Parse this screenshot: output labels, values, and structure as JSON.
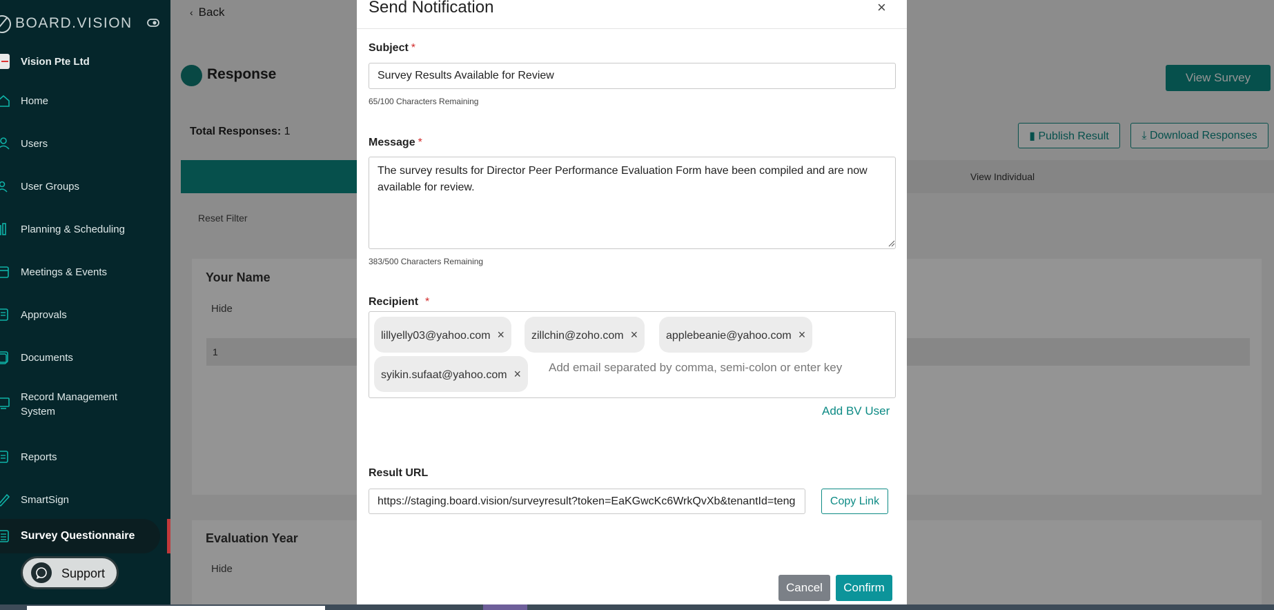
{
  "sidebar": {
    "brand": "BOARD.VISION",
    "company": "Vision Pte Ltd",
    "items": [
      {
        "label": "Home",
        "icon": "home-icon"
      },
      {
        "label": "Users",
        "icon": "user-icon"
      },
      {
        "label": "User Groups",
        "icon": "user-group-icon"
      },
      {
        "label": "Planning & Scheduling",
        "icon": "planning-icon"
      },
      {
        "label": "Meetings & Events",
        "icon": "calendar-icon"
      },
      {
        "label": "Approvals",
        "icon": "approvals-icon"
      },
      {
        "label": "Documents",
        "icon": "documents-icon"
      },
      {
        "label": "Record Management System",
        "icon": "records-icon"
      },
      {
        "label": "Reports",
        "icon": "reports-icon"
      },
      {
        "label": "SmartSign",
        "icon": "pen-icon"
      },
      {
        "label": "Survey Questionnaire",
        "icon": "survey-icon",
        "active": true
      }
    ],
    "support": "Support"
  },
  "page": {
    "back": "Back",
    "title": "Response",
    "view_survey": "View Survey",
    "total_label": "Total Responses:",
    "total_value": "1",
    "publish_result": "Publish Result",
    "download_responses": "Download Responses",
    "tab_individual": "View Individual",
    "reset_filter": "Reset Filter",
    "card1": {
      "title": "Your Name",
      "hide": "Hide",
      "row_value": "1"
    },
    "card2": {
      "title": "Evaluation Year",
      "hide": "Hide"
    }
  },
  "modal": {
    "title": "Send Notification",
    "close": "×",
    "subject_label": "Subject",
    "subject_value": "Survey Results Available for Review",
    "subject_hint": "65/100 Characters Remaining",
    "message_label": "Message",
    "message_value": "The survey results for Director Peer Performance Evaluation Form have been compiled and are now available for review.",
    "message_hint": "383/500 Characters Remaining",
    "recipient_label": "Recipient",
    "recipients": [
      "lillyelly03@yahoo.com",
      "zillchin@zoho.com",
      "applebeanie@yahoo.com",
      "syikin.sufaat@yahoo.com"
    ],
    "recipient_placeholder": "Add email separated by comma, semi-colon or enter key",
    "add_bv_user": "Add BV User",
    "result_url_label": "Result URL",
    "result_url_value": "https://staging.board.vision/surveyresult?token=EaKGwcKc6WrkQvXb&tenantId=teng",
    "copy_link": "Copy Link",
    "cancel": "Cancel",
    "confirm": "Confirm",
    "required_mark": "*"
  },
  "colors": {
    "accent": "#0c8a84",
    "sidebar": "#05262b",
    "danger": "#d12b2b"
  }
}
